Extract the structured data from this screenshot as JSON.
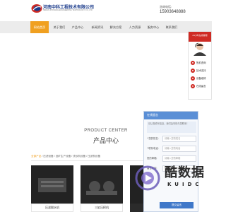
{
  "header": {
    "company_name": "河南中科工程技术有限公司",
    "company_en": "HENAN ZHONGKE ENGINEERING TECHNOLOGY CO.,LTD",
    "hotline_label": "咨询电话:",
    "hotline_number": "15903648888"
  },
  "nav": {
    "items": [
      {
        "label": "网站首页",
        "active": true
      },
      {
        "label": "关于我们",
        "active": false
      },
      {
        "label": "产品中心",
        "active": false
      },
      {
        "label": "新闻资讯",
        "active": false
      },
      {
        "label": "解决方案",
        "active": false
      },
      {
        "label": "人力资源",
        "active": false
      },
      {
        "label": "服务中心",
        "active": false
      },
      {
        "label": "联系我们",
        "active": false
      }
    ]
  },
  "service_panel": {
    "title": "24小时在线客服",
    "items": [
      {
        "label": "售前咨询"
      },
      {
        "label": "技术支持"
      },
      {
        "label": "设备维修"
      },
      {
        "label": "在线留言"
      }
    ]
  },
  "product_center": {
    "title_en": "PRODUCT CENTER",
    "title_cn": "产品中心"
  },
  "categories": {
    "first": "全部产品",
    "rest": " / 压滤设备 / 选矿生产设备 / 洗砂机设备 / 压滤机设备"
  },
  "products": [
    {
      "name": "压滤脱水机"
    },
    {
      "name": "三缸压榨机"
    },
    {
      "name": ""
    }
  ],
  "message_form": {
    "title": "在线留言",
    "note": "请认真填写信息，我们会尽快与您联系！",
    "fields": [
      {
        "label": "* 您的姓名:",
        "placeholder": "请输入您的姓名"
      },
      {
        "label": "* 联系电话:",
        "placeholder": "请输入您的电话"
      },
      {
        "label": "您的邮箱:",
        "placeholder": "请输入您的邮箱"
      },
      {
        "label": "留言内容:",
        "placeholder": "请输入留言内容"
      }
    ],
    "submit_label": "提交留言"
  },
  "watermark": {
    "text": "酷数据",
    "sub": "KUIDC"
  },
  "colors": {
    "accent_orange": "#f0a020",
    "service_red": "#cf2b24",
    "form_blue": "#5a8fd6",
    "nav_bg": "#ececec"
  }
}
